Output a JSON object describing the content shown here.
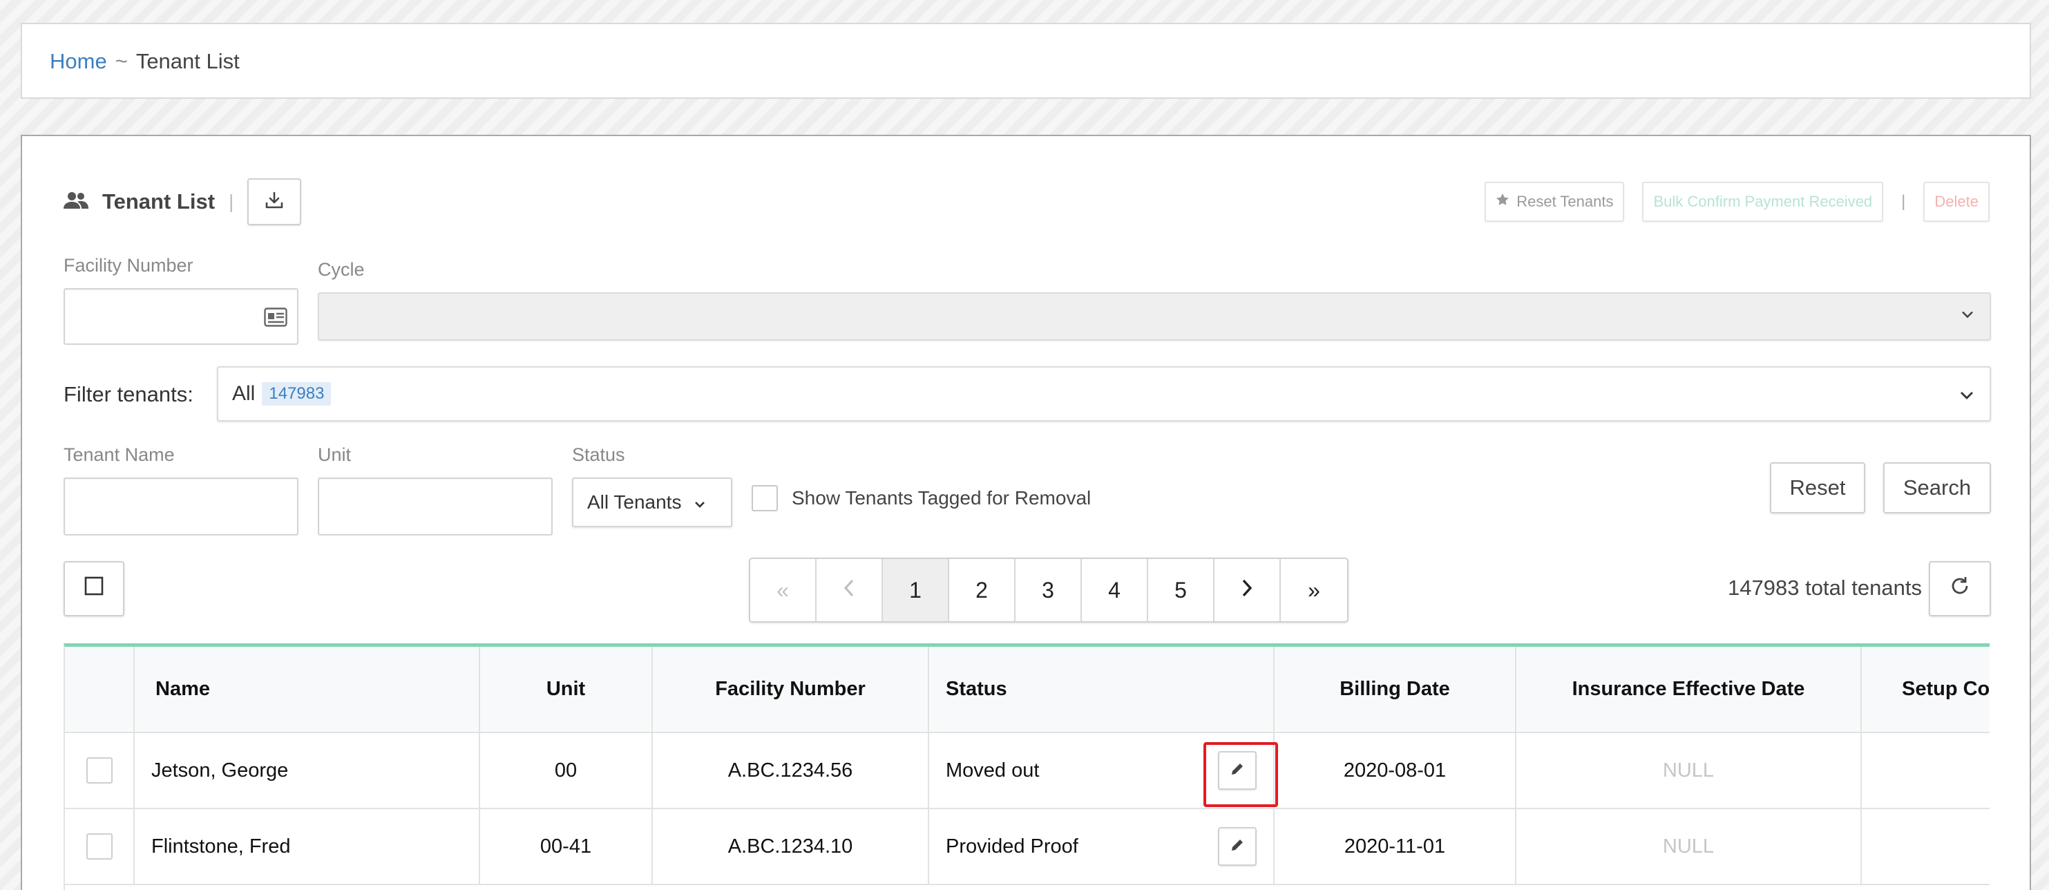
{
  "breadcrumb": {
    "home": "Home",
    "separator": "~",
    "current": "Tenant List"
  },
  "header": {
    "title": "Tenant List",
    "divider": "|",
    "reset_tenants": "Reset Tenants",
    "bulk_confirm": "Bulk Confirm Payment Received",
    "actions_divider": "|",
    "delete": "Delete"
  },
  "filters": {
    "facility_number_label": "Facility Number",
    "facility_number_value": "",
    "cycle_label": "Cycle",
    "cycle_value": "",
    "filter_tenants_label": "Filter tenants:",
    "filter_tenants_value": "All",
    "filter_tenants_count": "147983",
    "tenant_name_label": "Tenant Name",
    "tenant_name_value": "",
    "unit_label": "Unit",
    "unit_value": "",
    "status_label": "Status",
    "status_value": "All Tenants",
    "show_removal_label": "Show Tenants Tagged for Removal",
    "reset_button": "Reset",
    "search_button": "Search"
  },
  "pagination": {
    "pages": [
      "1",
      "2",
      "3",
      "4",
      "5"
    ],
    "current_page": 1,
    "first": "«",
    "last": "»"
  },
  "total_label": "147983 total tenants",
  "table": {
    "columns": [
      "Name",
      "Unit",
      "Facility Number",
      "Status",
      "Billing Date",
      "Insurance Effective Date",
      "Setup Co"
    ],
    "rows": [
      {
        "name": "Jetson, George",
        "unit": "00",
        "facility": "A.BC.1234.56",
        "status": "Moved out",
        "billing": "2020-08-01",
        "insurance": "NULL"
      },
      {
        "name": "Flintstone, Fred",
        "unit": "00-41",
        "facility": "A.BC.1234.10",
        "status": "Provided Proof",
        "billing": "2020-11-01",
        "insurance": "NULL"
      }
    ]
  },
  "colors": {
    "link": "#3a7fbf",
    "accent_border": "#7fd6b0",
    "highlight": "#e31b23"
  }
}
